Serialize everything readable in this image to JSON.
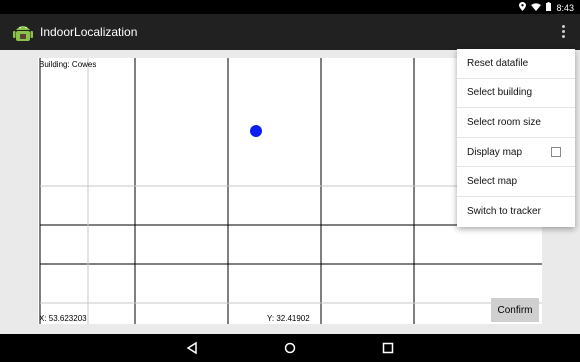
{
  "status_bar": {
    "time": "8:43",
    "icons": [
      "location-icon",
      "wifi-icon",
      "battery-icon"
    ]
  },
  "app": {
    "title": "IndoorLocalization",
    "icon": "android-icon"
  },
  "map": {
    "building_label": "Building: Cowes",
    "coord_x": "X: 53.623203",
    "coord_y": "Y: 32.41902",
    "point_color": "#0a1ff0"
  },
  "confirm_label": "Confirm",
  "menu": {
    "items": [
      {
        "label": "Reset datafile"
      },
      {
        "label": "Select building"
      },
      {
        "label": "Select room size"
      },
      {
        "label": "Display map",
        "checkbox": false
      },
      {
        "label": "Select map"
      },
      {
        "label": "Switch to tracker"
      }
    ]
  },
  "nav": [
    "back-icon",
    "home-icon",
    "recents-icon"
  ]
}
